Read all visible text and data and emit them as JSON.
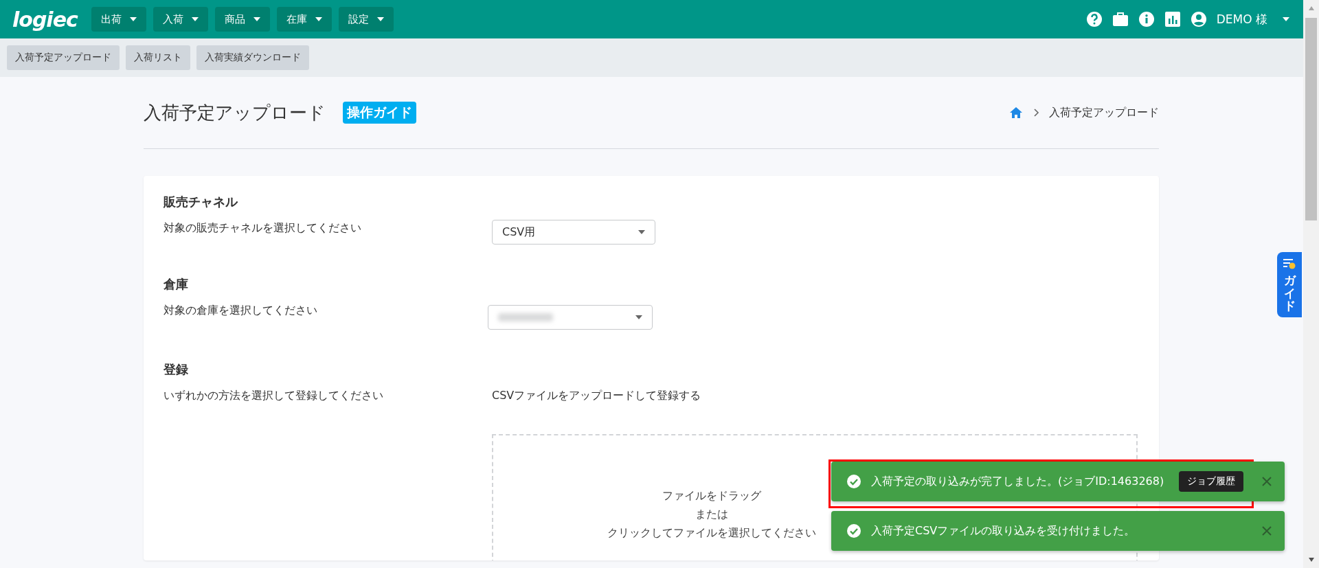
{
  "topbar": {
    "logo": "logiec",
    "menus": [
      {
        "label": "出荷"
      },
      {
        "label": "入荷"
      },
      {
        "label": "商品"
      },
      {
        "label": "在庫"
      },
      {
        "label": "設定"
      }
    ],
    "user": "DEMO 様"
  },
  "subnav": [
    {
      "label": "入荷予定アップロード"
    },
    {
      "label": "入荷リスト"
    },
    {
      "label": "入荷実績ダウンロード"
    }
  ],
  "page": {
    "title": "入荷予定アップロード",
    "guide_badge": "操作ガイド",
    "breadcrumb": [
      "入荷予定アップロード"
    ]
  },
  "form": {
    "sections": [
      {
        "kind": "select",
        "heading": "販売チャネル",
        "prompt": "対象の販売チャネルを選択してください",
        "value": "CSV用"
      },
      {
        "kind": "select_redacted",
        "heading": "倉庫",
        "prompt": "対象の倉庫を選択してください"
      },
      {
        "kind": "upload",
        "heading": "登録",
        "prompt": "いずれかの方法を選択して登録してください",
        "option": "CSVファイルをアップロードして登録する",
        "dropzone_lines": [
          "ファイルをドラッグ",
          "または",
          "クリックしてファイルを選択してください"
        ]
      }
    ]
  },
  "side_tab": {
    "label": "ガイド"
  },
  "toasts": [
    {
      "message": "入荷予定の取り込みが完了しました。(ジョブID:1463268)",
      "action": "ジョブ履歴",
      "highlighted": true
    },
    {
      "message": "入荷予定CSVファイルの取り込みを受け付けました。",
      "highlighted": false
    }
  ]
}
